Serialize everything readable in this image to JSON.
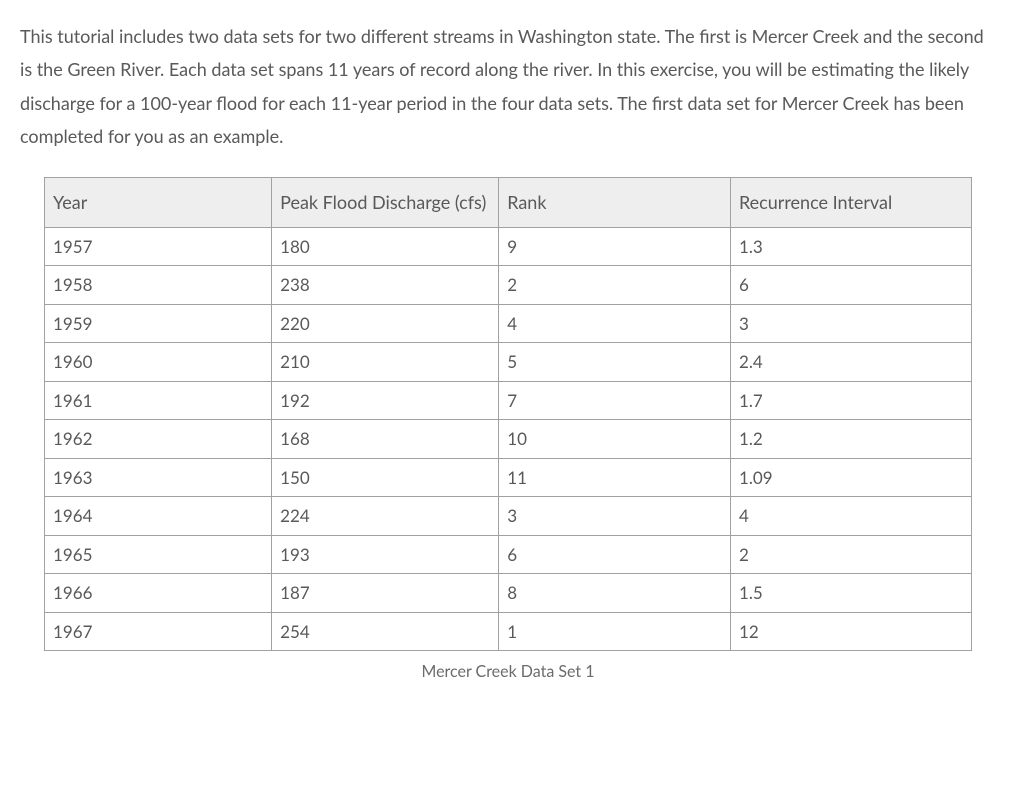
{
  "intro": "This tutorial includes two data sets for two different streams in Washington state. The first is Mercer Creek and the second is the Green River. Each data set spans 11 years of record along the river.  In this exercise, you will be estimating the likely discharge for a 100-year flood for each 11-year period in the four data sets. The first data set for Mercer Creek has been completed for you as an example.",
  "table": {
    "headers": {
      "year": "Year",
      "discharge": "Peak Flood Discharge (cfs)",
      "rank": "Rank",
      "recurrence": "Recurrence Interval"
    },
    "rows": [
      {
        "year": "1957",
        "discharge": "180",
        "rank": "9",
        "recurrence": "1.3"
      },
      {
        "year": "1958",
        "discharge": "238",
        "rank": "2",
        "recurrence": "6"
      },
      {
        "year": "1959",
        "discharge": "220",
        "rank": "4",
        "recurrence": "3"
      },
      {
        "year": "1960",
        "discharge": "210",
        "rank": "5",
        "recurrence": "2.4"
      },
      {
        "year": "1961",
        "discharge": "192",
        "rank": "7",
        "recurrence": "1.7"
      },
      {
        "year": "1962",
        "discharge": "168",
        "rank": "10",
        "recurrence": "1.2"
      },
      {
        "year": "1963",
        "discharge": "150",
        "rank": "11",
        "recurrence": "1.09"
      },
      {
        "year": "1964",
        "discharge": "224",
        "rank": "3",
        "recurrence": "4"
      },
      {
        "year": "1965",
        "discharge": "193",
        "rank": "6",
        "recurrence": "2"
      },
      {
        "year": "1966",
        "discharge": "187",
        "rank": "8",
        "recurrence": "1.5"
      },
      {
        "year": "1967",
        "discharge": "254",
        "rank": "1",
        "recurrence": "12"
      }
    ],
    "caption": "Mercer Creek Data Set 1"
  }
}
